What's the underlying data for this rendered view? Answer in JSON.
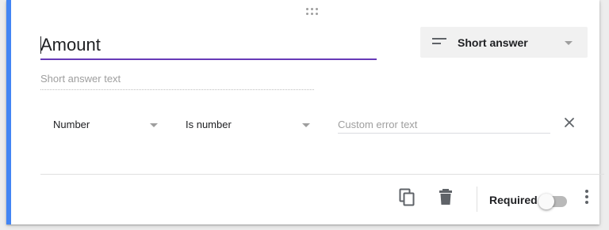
{
  "question": {
    "title": "Amount",
    "type_label": "Short answer",
    "type_icon": "short-answer-icon",
    "answer_placeholder": "Short answer text"
  },
  "validation": {
    "type_value": "Number",
    "condition_value": "Is number",
    "custom_error_value": "",
    "custom_error_placeholder": "Custom error text"
  },
  "footer": {
    "required_label": "Required",
    "required_on": false,
    "icons": [
      "copy-icon",
      "trash-icon",
      "more-vert-icon"
    ]
  },
  "colors": {
    "accent": "#673ab7",
    "card_left_border": "#4285f4"
  }
}
